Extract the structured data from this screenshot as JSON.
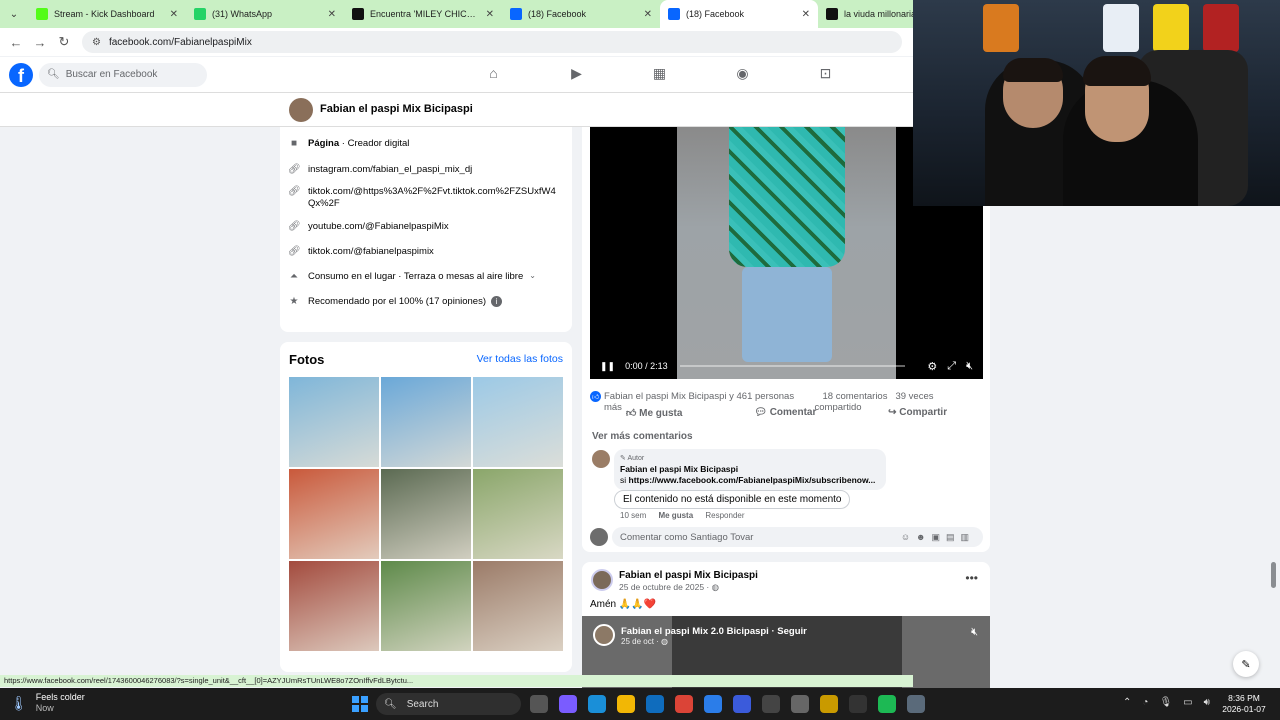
{
  "browser": {
    "tabs": [
      {
        "title": "Stream - Kick Dashboard",
        "favicon": "kick-icon",
        "color": "#53fc18",
        "active": false
      },
      {
        "title": "(31) WhatsApp",
        "favicon": "whatsapp-icon",
        "color": "#25d366",
        "active": false
      },
      {
        "title": "Encuentra 'MILEY CHICA SEXY'",
        "favicon": "tiktok-icon",
        "color": "#111111",
        "active": false
      },
      {
        "title": "(18) Facebook",
        "favicon": "facebook-icon",
        "color": "#0866ff",
        "active": false
      },
      {
        "title": "(18) Facebook",
        "favicon": "facebook-icon",
        "color": "#0866ff",
        "active": true
      },
      {
        "title": "la viuda millonaria (",
        "favicon": "tiktok-icon",
        "color": "#111111",
        "active": false
      }
    ],
    "url": "facebook.com/FabianelpaspiMix",
    "status_url": "https://www.facebook.com/reel/1743600046276083/?s=single_unit&__cft__[0]=AZYJUmRsTUnLWE8o7ZOnIffvFdLBytctu..."
  },
  "facebook": {
    "search_placeholder": "Buscar en Facebook",
    "nav_icons": [
      "home-icon",
      "video-icon",
      "marketplace-icon",
      "groups-icon",
      "gaming-icon"
    ]
  },
  "page": {
    "name": "Fabian el paspi Mix Bicipaspi",
    "intro": {
      "category_bold": "Página",
      "category_rest": " · Creador digital",
      "instagram": "instagram.com/fabian_el_paspi_mix_dj",
      "tiktok1": "tiktok.com/@https%3A%2F%2Fvt.tiktok.com%2FZSUxfW4Qx%2F",
      "youtube": "youtube.com/@FabianelpaspiMix",
      "tiktok2": "tiktok.com/@fabianelpaspimix",
      "services": "Consumo en el lugar · Terraza o mesas al aire libre",
      "rating": "Recomendado por el 100% (17 opiniones)"
    },
    "photos": {
      "title": "Fotos",
      "see_all": "Ver todas las fotos",
      "tile_colors": [
        "#7fb6d9",
        "#6aa8d8",
        "#9cc9e6",
        "#c9593b",
        "#5b6a52",
        "#8aa66a",
        "#a34b3e",
        "#5e8a4a",
        "#9b7b68"
      ]
    }
  },
  "post1": {
    "video_time": "0:00 / 2:13",
    "reactions_text": "Fabian el paspi Mix Bicipaspi y 461 personas más",
    "comments_count": "18 comentarios",
    "shares_count": "39 veces compartido",
    "like_label": "Me gusta",
    "comment_label": "Comentar",
    "share_label": "Compartir",
    "see_more_comments": "Ver más comentarios",
    "comment": {
      "author_tag": "Autor",
      "author": "Fabian el paspi Mix Bicipaspi",
      "text_prefix": "si ",
      "link": "https://www.facebook.com/FabianelpaspiMix/subscribenow...",
      "unavailable": "El contenido no está disponible en este momento",
      "age": "10 sem",
      "like": "Me gusta",
      "reply": "Responder"
    },
    "comment_input_placeholder": "Comentar como Santiago Tovar"
  },
  "post2": {
    "author": "Fabian el paspi Mix Bicipaspi",
    "date": "25 de octubre de 2025 · ",
    "text": "Amén 🙏🙏❤️",
    "shared_author": "Fabian el paspi Mix 2.0 Bicipaspi · Seguir",
    "shared_date": "25 de oct · "
  },
  "taskbar": {
    "weather_title": "Feels colder",
    "weather_sub": "Now",
    "search_label": "Search",
    "time": "8:36 PM",
    "date": "2026-01-07",
    "apps": [
      {
        "icon": "task-view-icon",
        "color": "#555555"
      },
      {
        "icon": "copilot-icon",
        "color": "#7a5cff"
      },
      {
        "icon": "edge-icon",
        "color": "#1a8fd8"
      },
      {
        "icon": "file-explorer-icon",
        "color": "#f2b705"
      },
      {
        "icon": "outlook-icon",
        "color": "#0f6cbd"
      },
      {
        "icon": "chrome-icon",
        "color": "#db4437"
      },
      {
        "icon": "store-icon",
        "color": "#2b7de9"
      },
      {
        "icon": "vpn-icon",
        "color": "#3b5bdb"
      },
      {
        "icon": "app-grid-icon",
        "color": "#444444"
      },
      {
        "icon": "tools-icon",
        "color": "#666666"
      },
      {
        "icon": "notes-icon",
        "color": "#c99a00"
      },
      {
        "icon": "obs-icon",
        "color": "#333333"
      },
      {
        "icon": "spotify-icon",
        "color": "#1db954"
      },
      {
        "icon": "settings-icon",
        "color": "#5a6a7a"
      }
    ]
  }
}
